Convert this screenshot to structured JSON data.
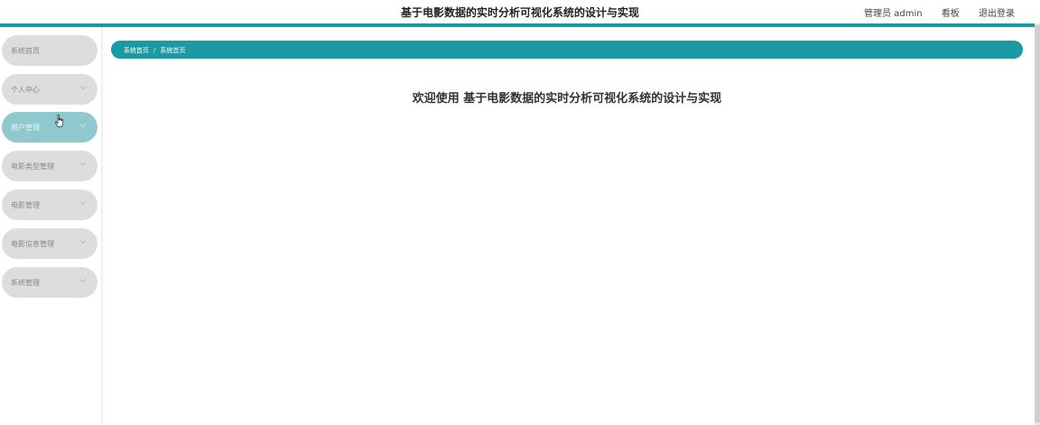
{
  "header": {
    "title": "基于电影数据的实时分析可视化系统的设计与实现",
    "user": "管理员 admin",
    "link_mid": "看板",
    "logout": "退出登录"
  },
  "sidebar": {
    "items": [
      {
        "label": "系统首页",
        "has_chevron": false,
        "active": false
      },
      {
        "label": "个人中心",
        "has_chevron": true,
        "active": false
      },
      {
        "label": "用户管理",
        "has_chevron": true,
        "active": true
      },
      {
        "label": "电影类型管理",
        "has_chevron": true,
        "active": false
      },
      {
        "label": "电影管理",
        "has_chevron": true,
        "active": false
      },
      {
        "label": "电影信息管理",
        "has_chevron": true,
        "active": false
      },
      {
        "label": "系统管理",
        "has_chevron": true,
        "active": false
      }
    ]
  },
  "breadcrumb": {
    "items": [
      "系统首页",
      "系统首页"
    ],
    "separator": "/"
  },
  "main": {
    "welcome": "欢迎使用 基于电影数据的实时分析可视化系统的设计与实现"
  },
  "colors": {
    "accent": "#1a9aa2",
    "menu_bg": "#dddddd",
    "menu_active_bg": "#8fc9cd"
  }
}
